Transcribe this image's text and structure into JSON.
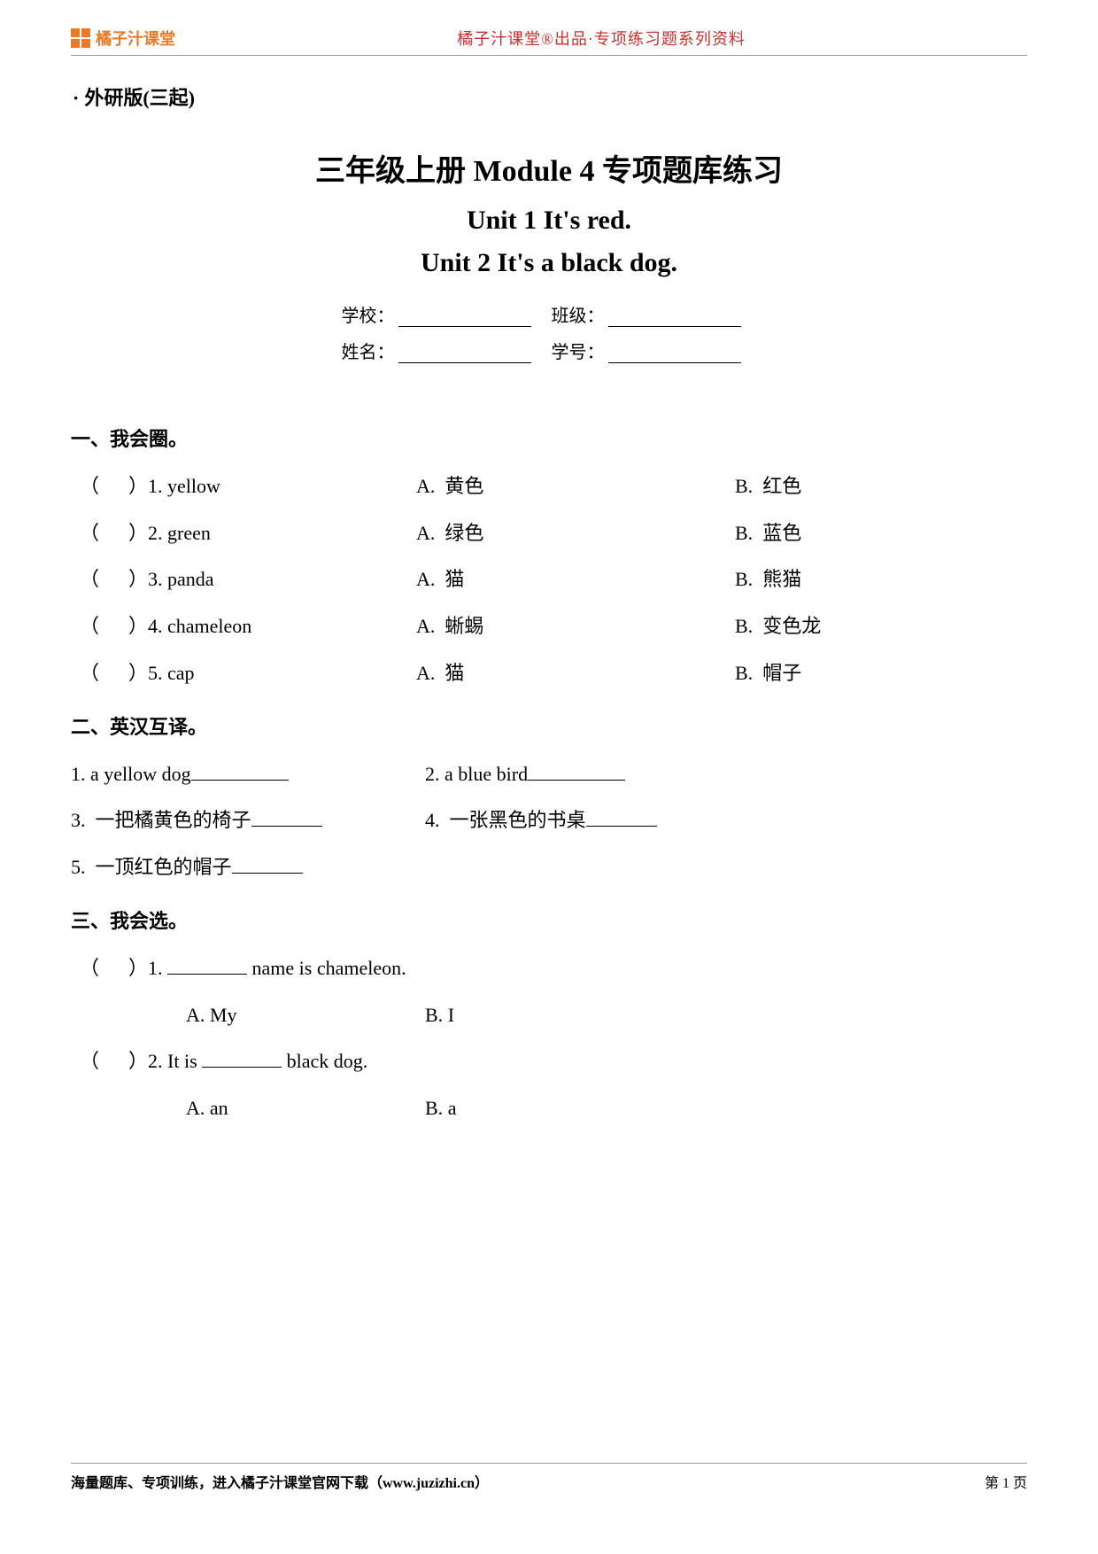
{
  "header": {
    "logo_text": "橘子汁课堂",
    "center_text": "橘子汁课堂®出品·专项练习题系列资料"
  },
  "edition": "外研版(三起)",
  "titles": {
    "main": "三年级上册 Module 4 专项题库练习",
    "unit1": "Unit 1 It's red.",
    "unit2": "Unit 2 It's a black dog."
  },
  "info_labels": {
    "school": "学校：",
    "class": "班级：",
    "name": "姓名：",
    "id": "学号："
  },
  "section1": {
    "heading": "一、我会圈。",
    "items": [
      {
        "num": "1",
        "word": "yellow",
        "a": "黄色",
        "b": "红色"
      },
      {
        "num": "2",
        "word": "green",
        "a": "绿色",
        "b": "蓝色"
      },
      {
        "num": "3",
        "word": "panda",
        "a": "猫",
        "b": "熊猫"
      },
      {
        "num": "4",
        "word": "chameleon",
        "a": "蜥蜴",
        "b": "变色龙"
      },
      {
        "num": "5",
        "word": "cap",
        "a": "猫",
        "b": "帽子"
      }
    ]
  },
  "section2": {
    "heading": "二、英汉互译。",
    "items": [
      {
        "num": "1",
        "text": "a yellow dog"
      },
      {
        "num": "2",
        "text": "a blue bird"
      },
      {
        "num": "3",
        "text": "一把橘黄色的椅子"
      },
      {
        "num": "4",
        "text": "一张黑色的书桌"
      },
      {
        "num": "5",
        "text": "一顶红色的帽子"
      }
    ]
  },
  "section3": {
    "heading": "三、我会选。",
    "items": [
      {
        "num": "1",
        "before": "",
        "after": " name is chameleon.",
        "a": "My",
        "b": "I"
      },
      {
        "num": "2",
        "before": "It is ",
        "after": " black dog.",
        "a": "an",
        "b": "a"
      }
    ]
  },
  "footer": {
    "left": "海量题库、专项训练，进入橘子汁课堂官网下载（www.juzizhi.cn）",
    "right": "第 1 页"
  }
}
